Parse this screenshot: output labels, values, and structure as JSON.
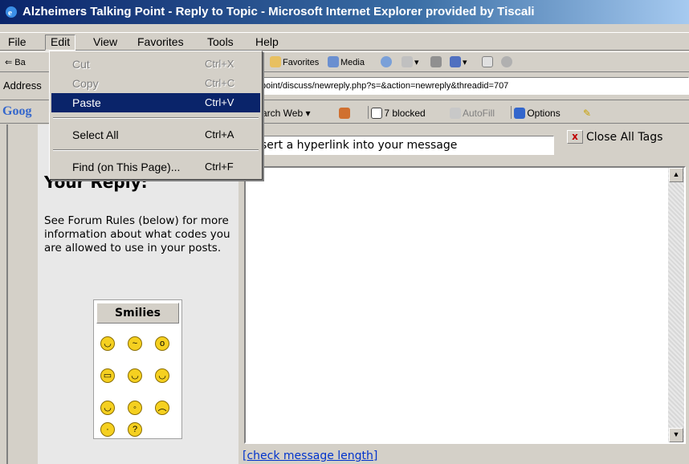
{
  "window": {
    "title": "Alzheimers Talking Point - Reply to Topic - Microsoft Internet Explorer provided by Tiscali"
  },
  "menubar": {
    "file": "File",
    "edit": "Edit",
    "view": "View",
    "favorites": "Favorites",
    "tools": "Tools",
    "help": "Help"
  },
  "toolbar": {
    "back": "Ba",
    "favorites": "Favorites",
    "media": "Media"
  },
  "addressbar": {
    "label": "Address",
    "value": "point/discuss/newreply.php?s=&action=newreply&threadid=707"
  },
  "googlebar": {
    "logo": "Goog",
    "search_web": "arch Web",
    "blocked": "7 blocked",
    "autofill": "AutoFill",
    "options": "Options"
  },
  "edit_menu": {
    "items": [
      {
        "label": "Cut",
        "shortcut": "Ctrl+X",
        "enabled": false
      },
      {
        "label": "Copy",
        "shortcut": "Ctrl+C",
        "enabled": false
      },
      {
        "label": "Paste",
        "shortcut": "Ctrl+V",
        "enabled": true
      },
      {
        "label": "Select All",
        "shortcut": "Ctrl+A",
        "enabled": true
      },
      {
        "label": "Find (on This Page)...",
        "shortcut": "Ctrl+F",
        "enabled": true
      }
    ]
  },
  "editor": {
    "hyperlink_hint": "sert a hyperlink into your message",
    "close_all_tags": "Close All Tags",
    "close_x": "x",
    "check_length": "[check message length]"
  },
  "left_panel": {
    "heading": "Your Reply:",
    "rules_text": "See Forum Rules (below) for more information about what codes you are allowed to use in your posts.",
    "smilies_title": "Smilies",
    "smilies": [
      "smile",
      "confused",
      "eek",
      "biggrin",
      "wink",
      "tongue",
      "cool",
      "rolleyes",
      "frown",
      "embarrassed",
      "question"
    ]
  },
  "colors": {
    "title_start": "#0a246a",
    "highlight": "#0a246a",
    "link": "#0033cc",
    "face": "#d4d0c8"
  }
}
